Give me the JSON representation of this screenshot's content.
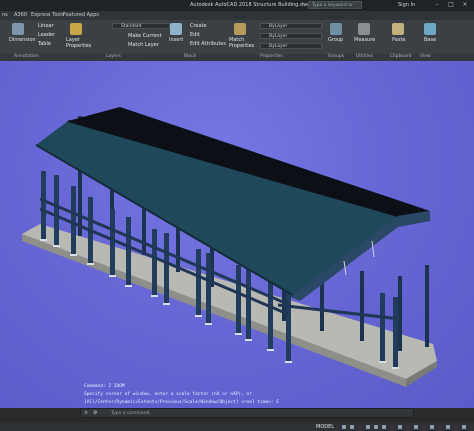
{
  "titlebar": {
    "title": "Autodesk AutoCAD 2018   Structure Building.dwg",
    "search_placeholder": "Type a keyword or phrase",
    "signin": "Sign In"
  },
  "tabs": [
    "ns",
    "A360",
    "Express Tools",
    "Featured Apps"
  ],
  "ribbon": {
    "linear": "Linear",
    "leader": "Leader",
    "table": "Table",
    "dimension": "Dimension",
    "layer_properties": "Layer Properties",
    "layer_standard": "Standard",
    "make_current": "Make Current",
    "match_layer": "Match Layer",
    "insert": "Insert",
    "create": "Create",
    "edit": "Edit",
    "edit_attributes": "Edit Attributes",
    "match_properties": "Match Properties",
    "bylayer": "ByLayer",
    "group": "Group",
    "measure": "Measure",
    "paste": "Paste",
    "base": "Base"
  },
  "panels": [
    "Annotation",
    "Layers",
    "Block",
    "Properties",
    "Groups",
    "Utilities",
    "Clipboard",
    "View"
  ],
  "command": {
    "line1": "Command: Z ZOOM",
    "line2": "Specify corner of window, enter a scale factor (nX or nXP), or",
    "line3": "[All/Center/Dynamic/Extents/Previous/Scale/Window/Object] <real time>: E",
    "placeholder": "Type a command"
  },
  "status": {
    "model": "MODEL"
  },
  "colors": {
    "viewport_bg": "#6767d6",
    "column": "#223a58",
    "roof": "#1d3d4e",
    "slab": "#b3b3ad"
  }
}
